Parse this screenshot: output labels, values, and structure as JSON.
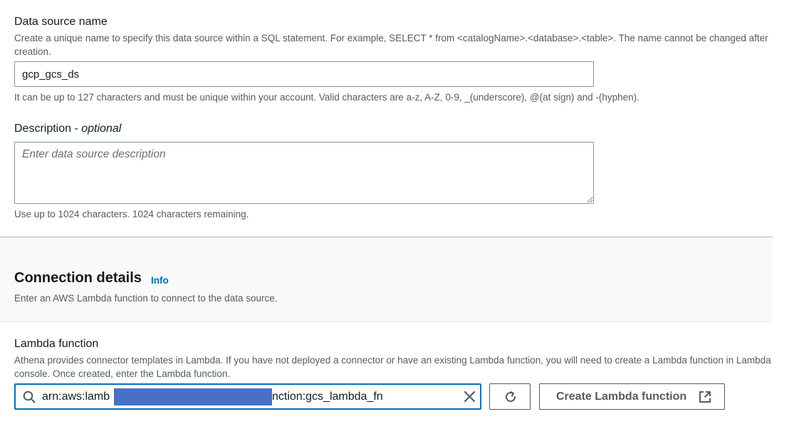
{
  "data_source": {
    "label": "Data source name",
    "description": "Create a unique name to specify this data source within a SQL statement. For example, SELECT * from <catalogName>.<database>.<table>. The name cannot be changed after creation.",
    "value": "gcp_gcs_ds",
    "constraint": "It can be up to 127 characters and must be unique within your account. Valid characters are a-z, A-Z, 0-9, _(underscore), @(at sign) and -(hyphen)."
  },
  "description_field": {
    "label": "Description - ",
    "label_optional": "optional",
    "placeholder": "Enter data source description",
    "constraint": "Use up to 1024 characters. 1024 characters remaining."
  },
  "connection": {
    "title": "Connection details",
    "info_link": "Info",
    "description": "Enter an AWS Lambda function to connect to the data source."
  },
  "lambda": {
    "label": "Lambda function",
    "description": "Athena provides connector templates in Lambda. If you have not deployed a connector or have an existing Lambda function, you will need to create a Lambda function in Lambda console. Once created, enter the Lambda function.",
    "value_prefix": "arn:aws:lamb",
    "value_suffix": "nction:gcs_lambda_fn",
    "create_button": "Create Lambda function"
  },
  "colors": {
    "accent": "#0073bb",
    "redaction": "#4a6fc7",
    "text": "#16191f",
    "muted": "#545b64"
  },
  "icons": [
    "search-icon",
    "clear-icon",
    "refresh-icon",
    "external-link-icon"
  ]
}
